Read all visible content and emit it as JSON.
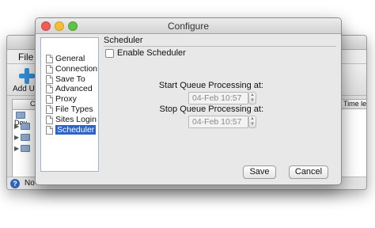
{
  "background_window": {
    "menu_file": "File",
    "toolbar_add_url": "Add UR",
    "table_col_header": "C",
    "table_row_first": "Dov",
    "right_col_header": "Time le",
    "status_text": "No"
  },
  "dialog": {
    "title": "Configure",
    "tree_items": [
      {
        "label": "General"
      },
      {
        "label": "Connection"
      },
      {
        "label": "Save To"
      },
      {
        "label": "Advanced"
      },
      {
        "label": "Proxy"
      },
      {
        "label": "File Types"
      },
      {
        "label": "Sites Login"
      },
      {
        "label": "Scheduler",
        "selected": true
      }
    ],
    "panel_title": "Scheduler",
    "enable_scheduler_label": "Enable Scheduler",
    "enable_scheduler_checked": false,
    "start_label": "Start Queue Processing at:",
    "start_value": "04-Feb 10:57",
    "stop_label": "Stop Queue Processing at:",
    "stop_value": "04-Feb 10:57",
    "save_label": "Save",
    "cancel_label": "Cancel"
  }
}
